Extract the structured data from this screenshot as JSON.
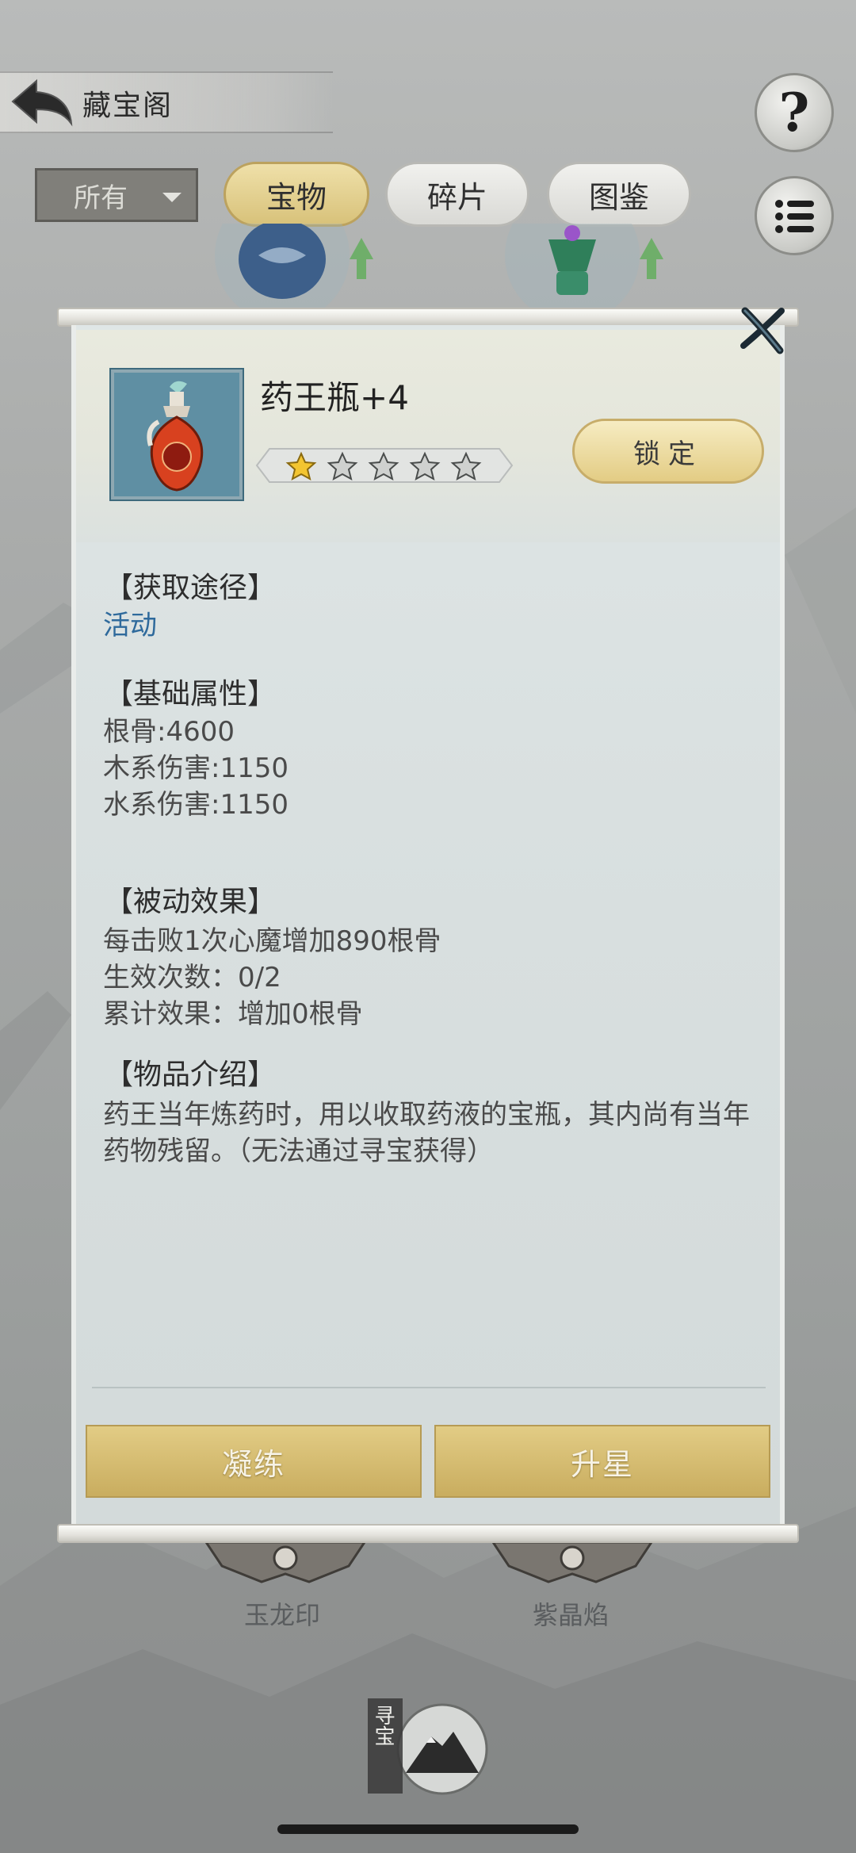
{
  "header": {
    "title": "藏宝阁",
    "help_symbol": "?"
  },
  "filter": {
    "selected": "所有"
  },
  "tabs": [
    {
      "label": "宝物",
      "active": true
    },
    {
      "label": "碎片",
      "active": false
    },
    {
      "label": "图鉴",
      "active": false
    }
  ],
  "background_items": [
    {
      "label": "玉龙印"
    },
    {
      "label": "紫晶焰"
    }
  ],
  "bottom_badge": {
    "text": "寻宝"
  },
  "dialog": {
    "item_name": "药王瓶+4",
    "stars_filled": 1,
    "stars_total": 5,
    "lock_label": "锁定",
    "acquire": {
      "title": "【获取途径】",
      "value": "活动"
    },
    "base_stats": {
      "title": "【基础属性】",
      "lines": [
        "根骨:4600",
        "木系伤害:1150",
        "水系伤害:1150"
      ]
    },
    "passive": {
      "title": "【被动效果】",
      "lines": [
        "每击败1次心魔增加890根骨",
        "生效次数：0/2",
        "累计效果：增加0根骨"
      ]
    },
    "intro": {
      "title": "【物品介绍】",
      "text": "药王当年炼药时，用以收取药液的宝瓶，其内尚有当年药物残留。（无法通过寻宝获得）"
    },
    "buttons": {
      "refine": "凝练",
      "upgrade_star": "升星"
    }
  },
  "colors": {
    "accent_gold": "#d8c27a",
    "link_blue": "#2f6a9c",
    "panel": "#dfe6e6"
  }
}
